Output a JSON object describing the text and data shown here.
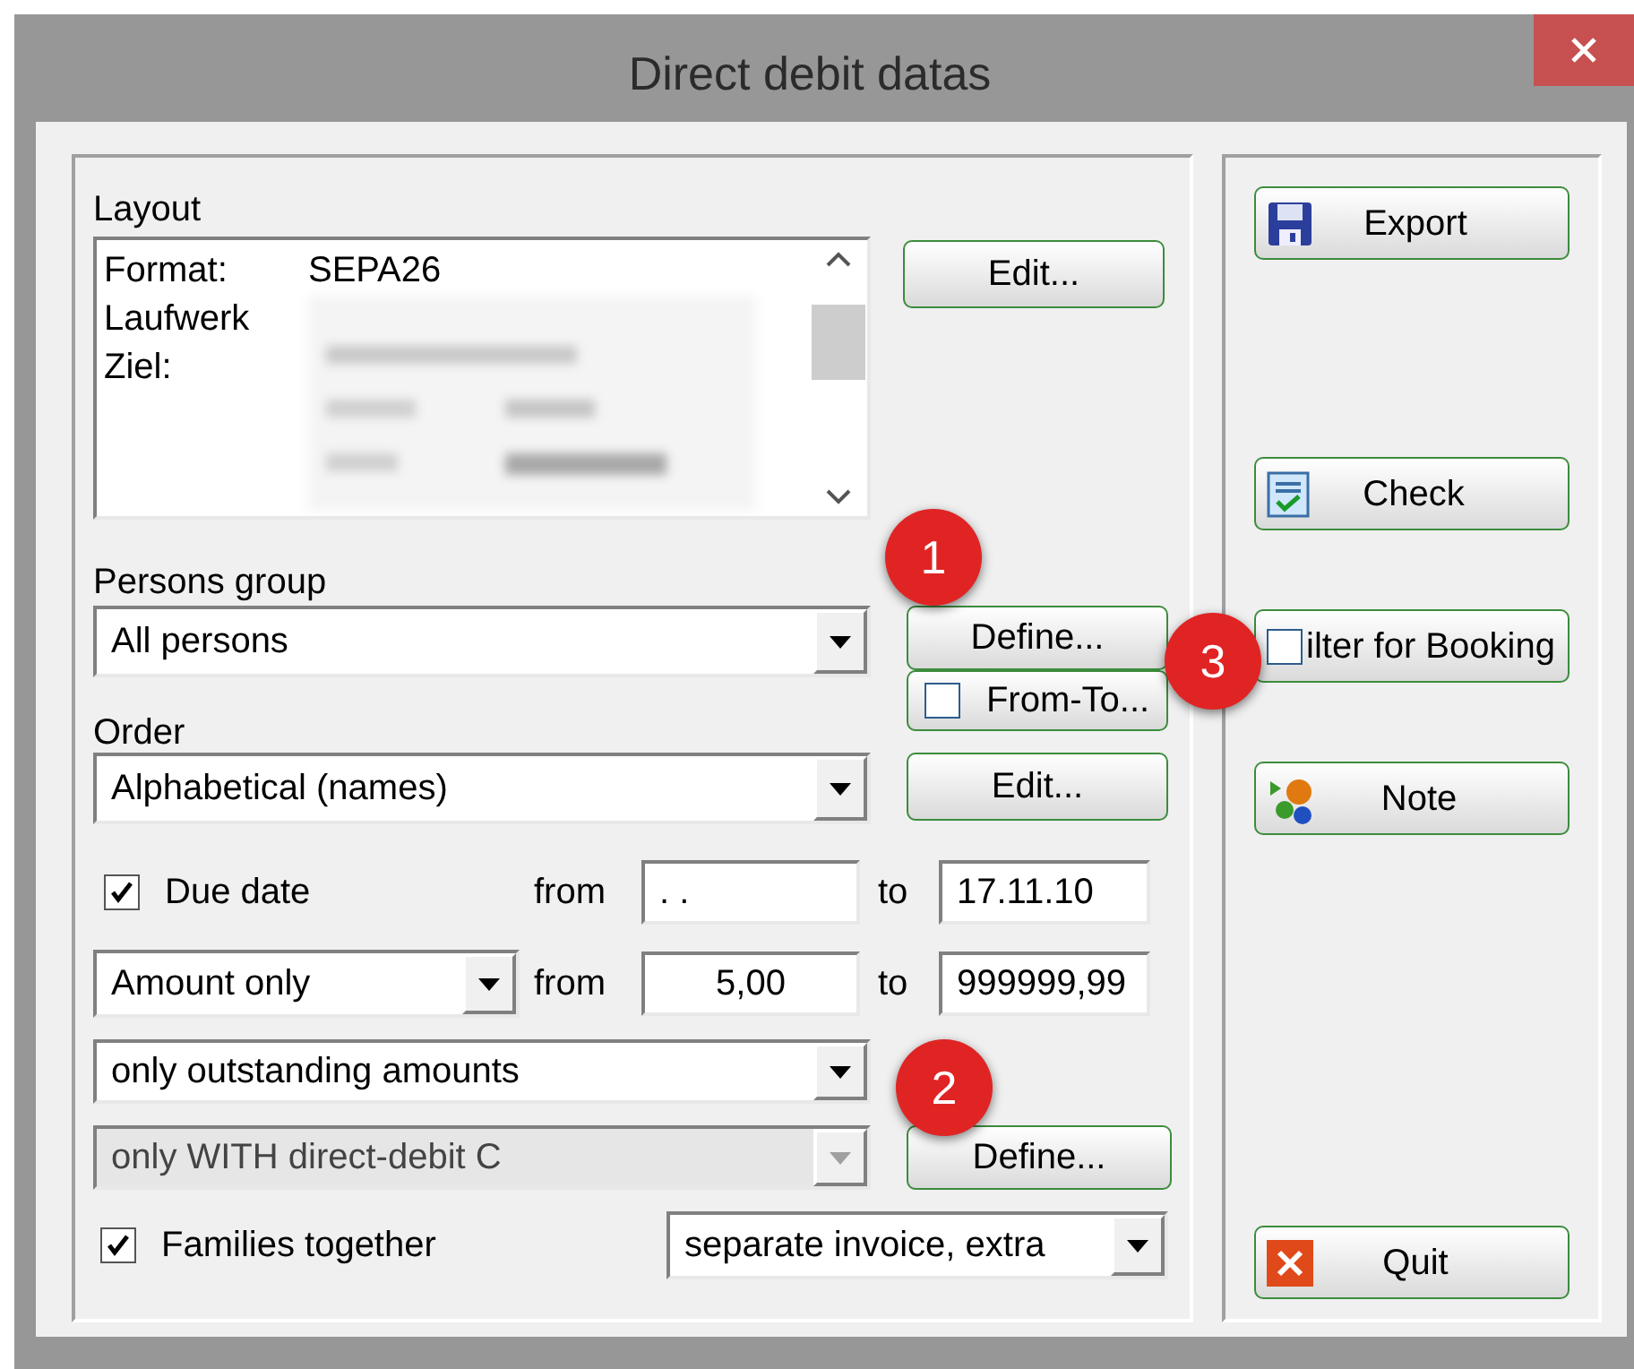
{
  "window": {
    "title": "Direct debit datas"
  },
  "layout": {
    "label": "Layout",
    "list": [
      {
        "label": "Format:",
        "value": "SEPA26"
      },
      {
        "label": "Laufwerk"
      },
      {
        "label": "Ziel:"
      }
    ],
    "edit_button": "Edit..."
  },
  "persons_group": {
    "label": "Persons group",
    "combo": {
      "value": "All persons",
      "disabled": false
    },
    "define_button": "Define...",
    "from_to": {
      "label": "From-To...",
      "checked": false
    }
  },
  "order": {
    "label": "Order",
    "combo": {
      "value": "Alphabetical (names)",
      "disabled": false
    },
    "edit_button": "Edit..."
  },
  "due_date": {
    "label": "Due date",
    "checked": true,
    "from_label": "from",
    "from_value": ". .",
    "to_label": "to",
    "to_value": "17.11.10"
  },
  "amount": {
    "combo": {
      "value": "Amount only",
      "disabled": false
    },
    "from_label": "from",
    "from_value": "5,00",
    "to_label": "to",
    "to_value": "999999,99"
  },
  "outstanding_combo": {
    "value": "only outstanding amounts",
    "disabled": false
  },
  "direct_debit_combo": {
    "value": "only WITH direct-debit C",
    "disabled": true
  },
  "define_button": "Define...",
  "families": {
    "label": "Families together",
    "checked": true,
    "combo": {
      "value": "separate invoice, extra",
      "disabled": false
    }
  },
  "actions": [
    {
      "kind": "export",
      "label": "Export"
    },
    {
      "kind": "check",
      "label": "Check"
    },
    {
      "kind": "filter",
      "label": "ilter for Booking",
      "checked": false
    },
    {
      "kind": "note",
      "label": "Note"
    },
    {
      "kind": "quit",
      "label": "Quit"
    }
  ],
  "badges": [
    "1",
    "2",
    "3"
  ]
}
